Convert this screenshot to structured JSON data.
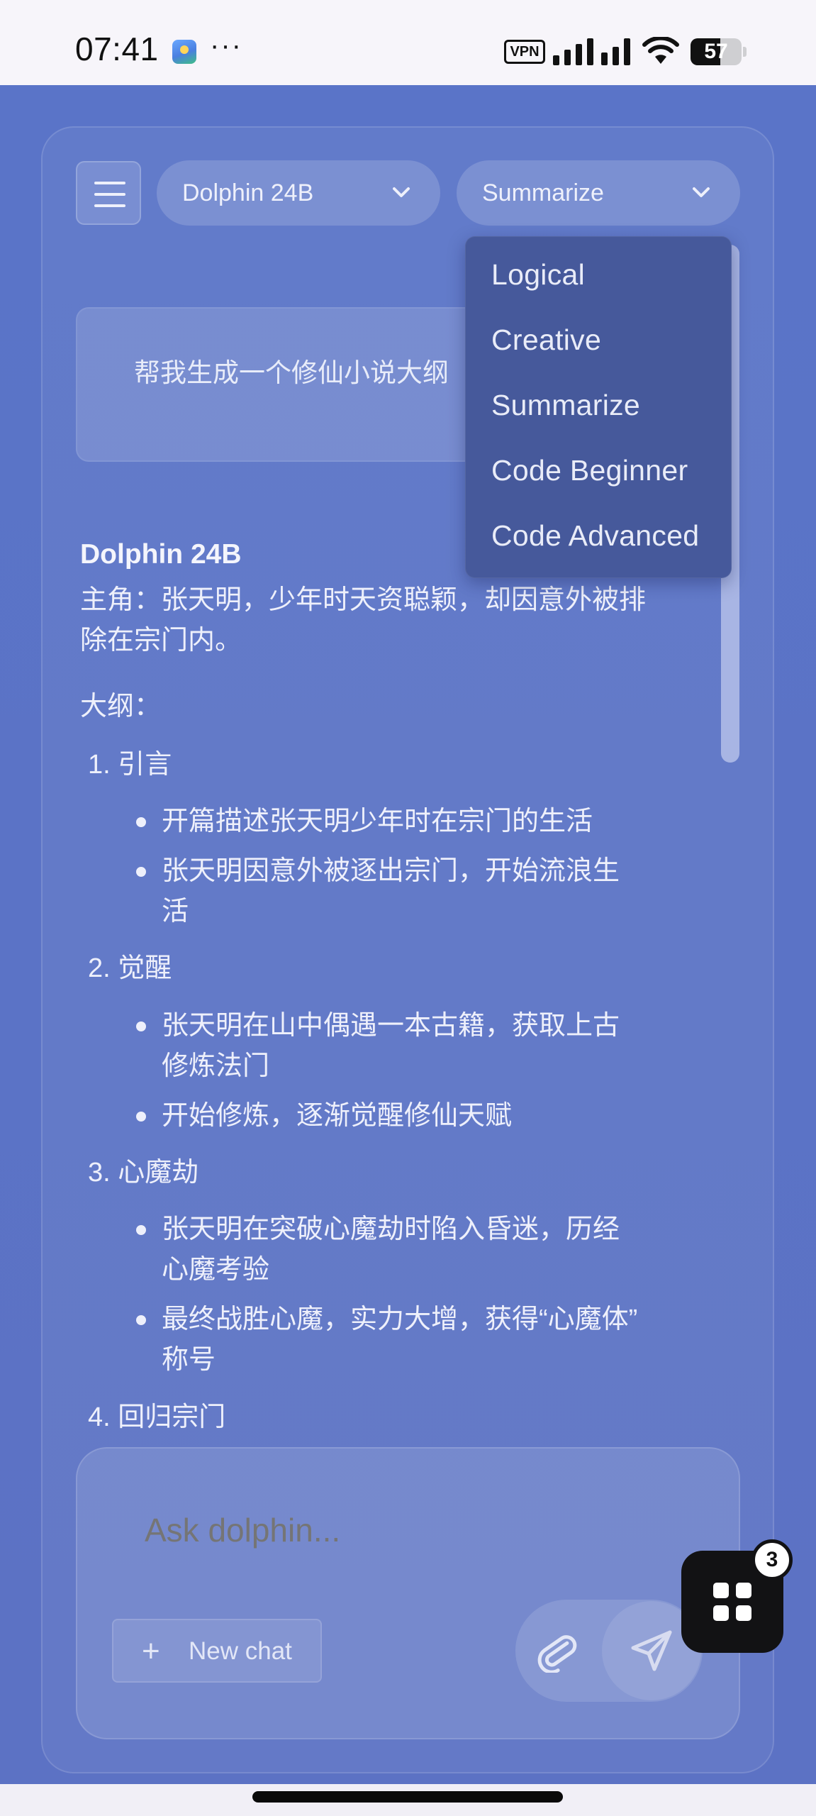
{
  "status_bar": {
    "time": "07:41",
    "dots": "···",
    "vpn": "VPN",
    "battery": "57"
  },
  "header": {
    "menu_icon": "hamburger-menu-icon",
    "model_select": "Dolphin 24B",
    "mode_select": "Summarize"
  },
  "mode_dropdown": {
    "options": [
      "Logical",
      "Creative",
      "Summarize",
      "Code Beginner",
      "Code Advanced"
    ]
  },
  "user_message": "帮我生成一个修仙小说大纲",
  "response": {
    "model_name": "Dolphin 24B",
    "intro_line1": "主角：张天明，少年时天资聪颖，却因意外被排",
    "intro_line2": "除在宗门内。",
    "outline_label": "大纲：",
    "sections": [
      {
        "title": "1. 引言",
        "bullets": [
          [
            "开篇描述张天明少年时在宗门的生活"
          ],
          [
            "张天明因意外被逐出宗门，开始流浪生",
            "活"
          ]
        ]
      },
      {
        "title": "2. 觉醒",
        "bullets": [
          [
            "张天明在山中偶遇一本古籍，获取上古",
            "修炼法门"
          ],
          [
            "开始修炼，逐渐觉醒修仙天赋"
          ]
        ]
      },
      {
        "title": "3. 心魔劫",
        "bullets": [
          [
            "张天明在突破心魔劫时陷入昏迷，历经",
            "心魔考验"
          ],
          [
            "最终战胜心魔，实力大增，获得“心魔体”",
            "称号"
          ]
        ]
      },
      {
        "title": "4. 回归宗门",
        "bullets": []
      }
    ]
  },
  "composer": {
    "placeholder": "Ask dolphin...",
    "new_chat_label": "New chat",
    "attach_icon": "paperclip-icon",
    "send_icon": "send-icon"
  },
  "fab": {
    "icon": "apps-grid-icon",
    "badge": "3"
  },
  "colors": {
    "background": "#5a74c8",
    "dropdown": "#46599b",
    "fab": "#121214"
  }
}
